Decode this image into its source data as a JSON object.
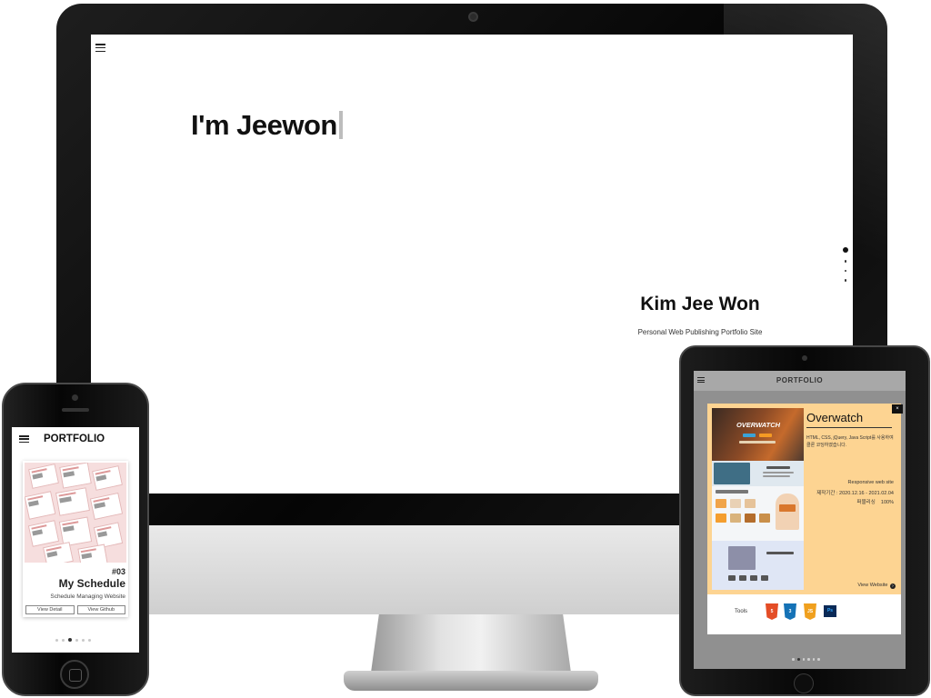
{
  "desktop": {
    "hero_heading": "I'm Jeewon",
    "name": "Kim Jee Won",
    "subtitle": "Personal Web Publishing Portfolio Site",
    "menu_icon": "hamburger-menu-icon",
    "section_dots": {
      "count": 4,
      "active_index": 0
    }
  },
  "phone": {
    "title": "PORTFOLIO",
    "menu_icon": "hamburger-menu-icon",
    "project": {
      "number": "#03",
      "title": "My Schedule",
      "description": "Schedule Managing Website",
      "view_detail_label": "View Detail",
      "view_github_label": "View Github"
    },
    "pagination": {
      "count": 6,
      "active_index": 2
    }
  },
  "tablet": {
    "title": "PORTFOLIO",
    "menu_icon": "hamburger-menu-icon",
    "modal": {
      "close_label": "×",
      "title": "Overwatch",
      "description": "HTML, CSS, jQuery, Java Script를 사용하여 클론 코딩하였습니다.",
      "type": "Responsive web site",
      "period": "제작기간 : 2020.12.16 - 2021.02.04",
      "contribution_label": "퍼블리싱",
      "contribution_value": "100%",
      "view_website_label": "View Website",
      "view_website_icon": "arrow-right-circle-icon",
      "screenshot_logo": "OVERWATCH"
    },
    "tools": {
      "label": "Tools",
      "items": [
        {
          "name": "HTML",
          "icon": "html5-icon",
          "color": "#e44d26"
        },
        {
          "name": "CSS",
          "icon": "css3-icon",
          "color": "#1572b6"
        },
        {
          "name": "JS",
          "icon": "javascript-icon",
          "color": "#f0a01e"
        },
        {
          "name": "Ps",
          "icon": "photoshop-icon",
          "color": "#0a2a57"
        }
      ]
    },
    "pagination": {
      "count": 6,
      "active_index": 1
    }
  },
  "colors": {
    "modal_background": "#fdd492",
    "tablet_screen_background": "#909090",
    "phone_thumbnail_background": "#f6dede"
  }
}
